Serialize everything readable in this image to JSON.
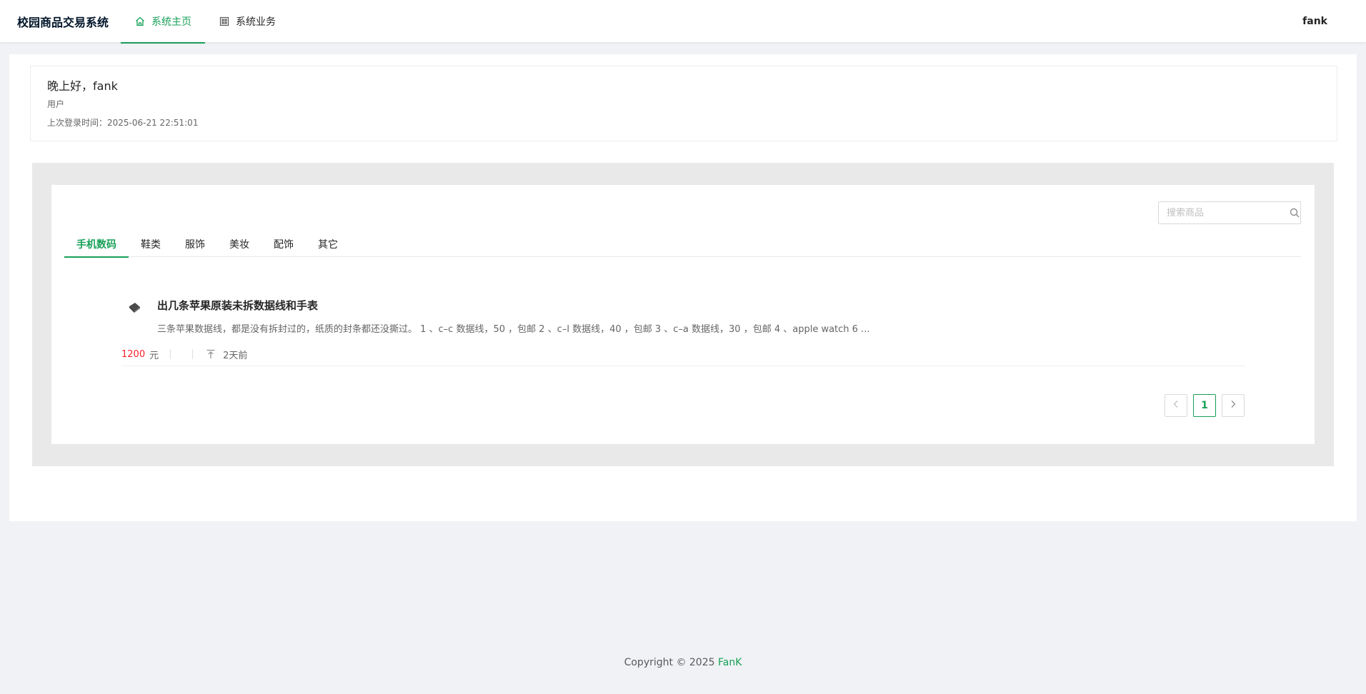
{
  "header": {
    "brand": "校园商品交易系统",
    "nav": [
      {
        "label": "系统主页",
        "icon": "home-icon",
        "active": true
      },
      {
        "label": "系统业务",
        "icon": "grid-icon",
        "active": false
      }
    ],
    "user": "fank"
  },
  "welcome": {
    "greeting": "晚上好，fank",
    "role": "用户",
    "last_login": "上次登录时间：2025-06-21 22:51:01"
  },
  "search": {
    "placeholder": "搜索商品"
  },
  "tabs": [
    {
      "label": "手机数码",
      "active": true
    },
    {
      "label": "鞋类"
    },
    {
      "label": "服饰"
    },
    {
      "label": "美妆"
    },
    {
      "label": "配饰"
    },
    {
      "label": "其它"
    }
  ],
  "items": [
    {
      "title": "出几条苹果原装未拆数据线和手表",
      "description": "三条苹果数据线，都是没有拆封过的，纸质的封条都还没撕过。 1 、c–c 数据线，50 ，包邮 2 、c–l 数据线，40 ，包邮 3 、c–a 数据线，30 ，包邮 4 、apple watch 6 ...",
      "price": "1200",
      "unit": "元",
      "time": "2天前"
    }
  ],
  "pagination": {
    "current": "1"
  },
  "footer": {
    "copyright": "Copyright © 2025 ",
    "author": "FanK"
  },
  "colors": {
    "accent": "#18a058",
    "price": "#f5222d"
  }
}
